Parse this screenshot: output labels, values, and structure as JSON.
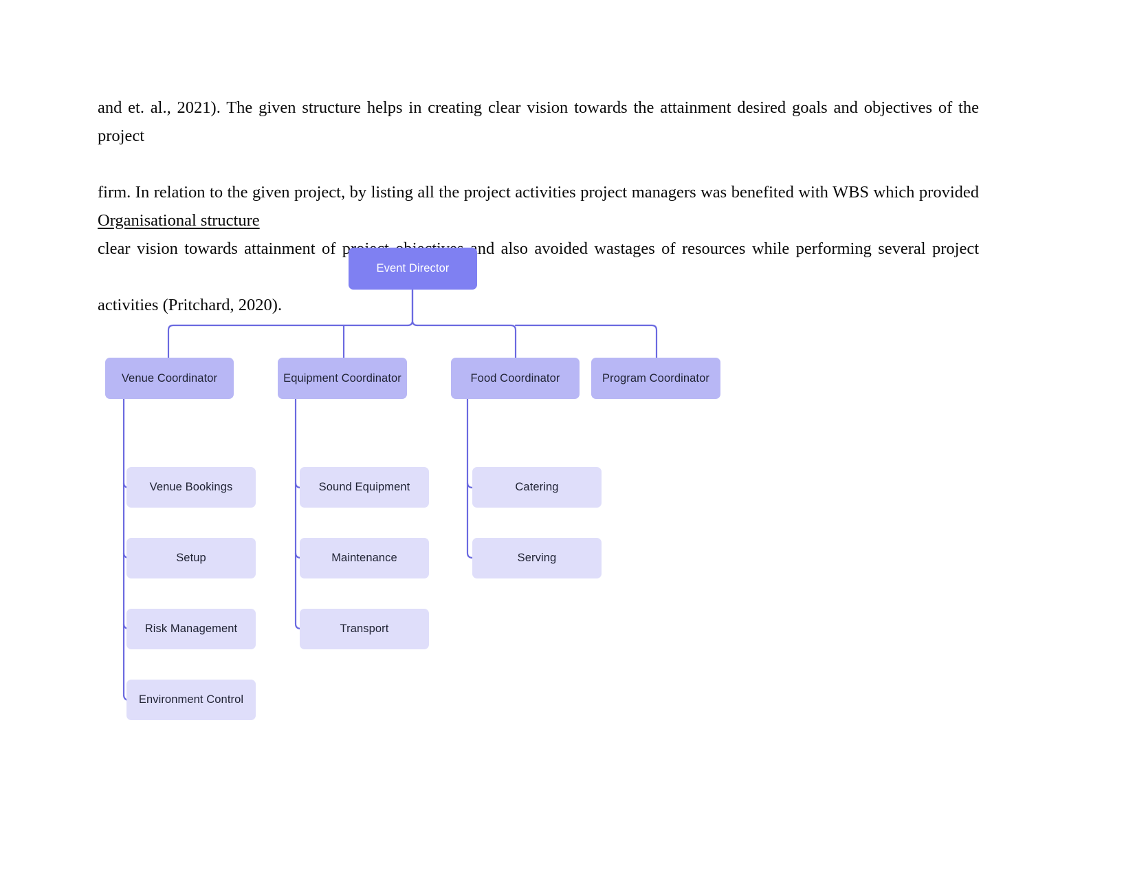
{
  "document": {
    "paragraph_lines": [
      "and et. al., 2021). The given structure helps in creating clear vision towards the attainment desired goals and objectives of the project",
      "firm. In relation to the given project, by listing all the project activities project managers was benefited with WBS which provided",
      "clear vision towards attainment of project objectives and also avoided wastages of resources while performing several project",
      "activities (Pritchard, 2020)."
    ],
    "heading": "Organisational structure"
  },
  "colors": {
    "root_fill": "#7f80f2",
    "root_text": "#ffffff",
    "level2_fill": "#b8b7f5",
    "level3_fill": "#dfdefa",
    "node_text": "#1f2233",
    "connector": "#6a69e0",
    "page_background": "#ffffff"
  },
  "chart_data": {
    "type": "diagram",
    "diagram_type": "organisational-chart",
    "title": "Organisational structure",
    "root": {
      "label": "Event Director",
      "level": 1
    },
    "branches": [
      {
        "label": "Venue Coordinator",
        "level": 2,
        "children": [
          "Venue Bookings",
          "Setup",
          "Risk Management",
          "Environment Control"
        ]
      },
      {
        "label": "Equipment Coordinator",
        "level": 2,
        "children": [
          "Sound Equipment",
          "Maintenance",
          "Transport"
        ]
      },
      {
        "label": "Food Coordinator",
        "level": 2,
        "children": [
          "Catering",
          "Serving"
        ]
      },
      {
        "label": "Program Coordinator",
        "level": 2,
        "children": []
      }
    ]
  },
  "nodes": {
    "root": "Event Director",
    "venue_coordinator": "Venue Coordinator",
    "equipment_coordinator": "Equipment Coordinator",
    "food_coordinator": "Food Coordinator",
    "program_coordinator": "Program Coordinator",
    "venue_bookings": "Venue Bookings",
    "setup": "Setup",
    "risk_management": "Risk Management",
    "environment_control": "Environment Control",
    "sound_equipment": "Sound Equipment",
    "maintenance": "Maintenance",
    "transport": "Transport",
    "catering": "Catering",
    "serving": "Serving"
  }
}
